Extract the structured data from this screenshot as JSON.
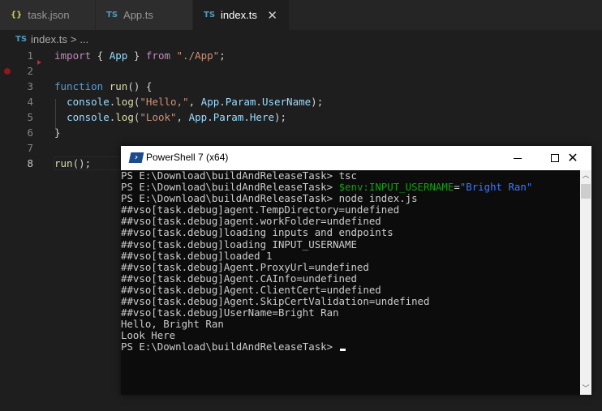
{
  "tabs": [
    {
      "icon": "{}",
      "label": "task.json",
      "active": false
    },
    {
      "icon": "TS",
      "label": "App.ts",
      "active": false
    },
    {
      "icon": "TS",
      "label": "index.ts",
      "active": true,
      "close": "✕"
    }
  ],
  "breadcrumb": {
    "icon": "TS",
    "file": "index.ts",
    "separator": ">",
    "more": "..."
  },
  "editor": {
    "current_line": 8,
    "lines": [
      {
        "n": "1"
      },
      {
        "n": "2"
      },
      {
        "n": "3"
      },
      {
        "n": "4"
      },
      {
        "n": "5"
      },
      {
        "n": "6"
      },
      {
        "n": "7"
      },
      {
        "n": "8"
      }
    ],
    "tokens": {
      "l1": [
        "import",
        " { ",
        "App",
        " } ",
        "from",
        " ",
        "\"./App\"",
        ";"
      ],
      "l3": [
        "function",
        " ",
        "run",
        "() {"
      ],
      "l4": [
        "  ",
        "console",
        ".",
        "log",
        "(",
        "\"Hello,\"",
        ", ",
        "App",
        ".",
        "Param",
        ".",
        "UserName",
        ");"
      ],
      "l5": [
        "  ",
        "console",
        ".",
        "log",
        "(",
        "\"Look\"",
        ", ",
        "App",
        ".",
        "Param",
        ".",
        "Here",
        ");"
      ],
      "l6": [
        "}"
      ],
      "l8": [
        "run",
        "();"
      ]
    }
  },
  "powershell": {
    "title": "PowerShell 7 (x64)",
    "icon": ">_",
    "controls": {
      "minimize": "minimize",
      "maximize": "maximize",
      "close": "✕"
    },
    "prompt": "PS E:\\Download\\buildAndReleaseTask> ",
    "commands": {
      "c1": "tsc",
      "c2_var": "$env:INPUT_USERNAME",
      "c2_eq": "=",
      "c2_str": "\"Bright Ran\"",
      "c3_cmd": "node",
      "c3_arg": " index.js"
    },
    "output": [
      "##vso[task.debug]agent.TempDirectory=undefined",
      "##vso[task.debug]agent.workFolder=undefined",
      "##vso[task.debug]loading inputs and endpoints",
      "##vso[task.debug]loading INPUT_USERNAME",
      "##vso[task.debug]loaded 1",
      "##vso[task.debug]Agent.ProxyUrl=undefined",
      "##vso[task.debug]Agent.CAInfo=undefined",
      "##vso[task.debug]Agent.ClientCert=undefined",
      "##vso[task.debug]Agent.SkipCertValidation=undefined",
      "##vso[task.debug]UserName=Bright Ran",
      "Hello, Bright Ran",
      "Look Here"
    ],
    "scroll": {
      "up": "▲",
      "down": "▼"
    }
  }
}
